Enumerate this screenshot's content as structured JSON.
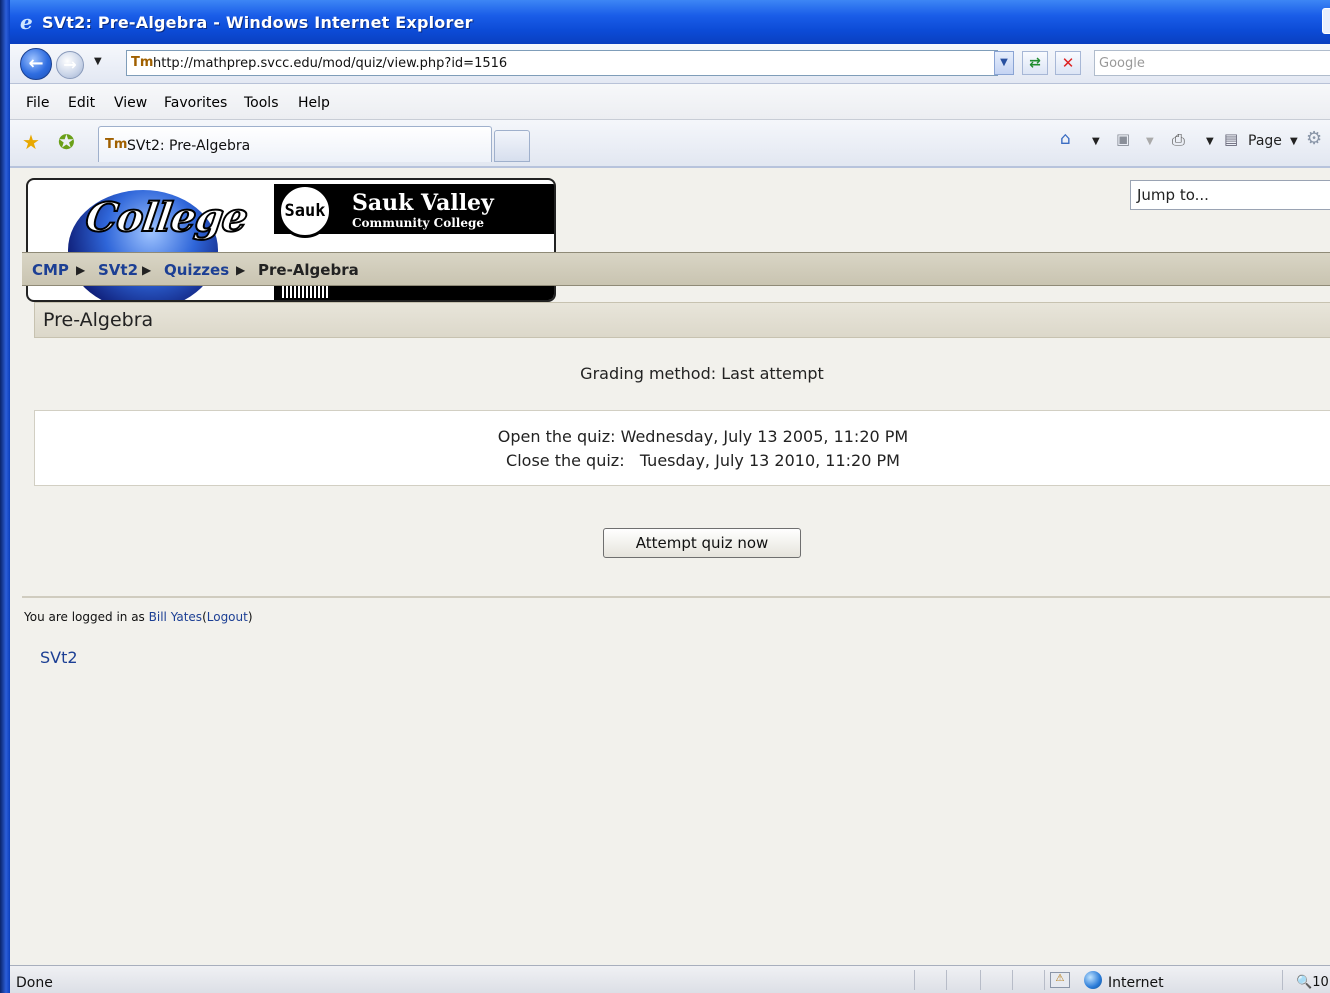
{
  "window": {
    "title": "SVt2: Pre-Algebra - Windows Internet Explorer"
  },
  "addressbar": {
    "url": "http://mathprep.svcc.edu/mod/quiz/view.php?id=1516",
    "search_placeholder": "Google"
  },
  "menu": {
    "items": [
      "File",
      "Edit",
      "View",
      "Favorites",
      "Tools",
      "Help"
    ]
  },
  "tabs": {
    "active_label": "SVt2: Pre-Algebra"
  },
  "commandbar": {
    "page_label": "Page"
  },
  "header": {
    "logo_college": "College",
    "logo_sauk_badge": "Sauk",
    "logo_title": "Sauk Valley",
    "logo_subtitle": "Community College",
    "jump_to": "Jump to..."
  },
  "breadcrumb": {
    "items": [
      "CMP",
      "SVt2",
      "Quizzes",
      "Pre-Algebra"
    ]
  },
  "page": {
    "heading": "Pre-Algebra",
    "grading_method": "Grading method: Last attempt",
    "open_quiz": "Open the quiz: Wednesday, July 13 2005, 11:20 PM",
    "close_quiz": "Close the quiz:   Tuesday, July 13 2010, 11:20 PM",
    "attempt_button": "Attempt quiz now"
  },
  "footer": {
    "logged_in_prefix": "You are logged in as",
    "user_name": "Bill Yates",
    "logout_label": "Logout",
    "course_link": "SVt2"
  },
  "statusbar": {
    "status": "Done",
    "zone": "Internet",
    "zoom": "10"
  }
}
